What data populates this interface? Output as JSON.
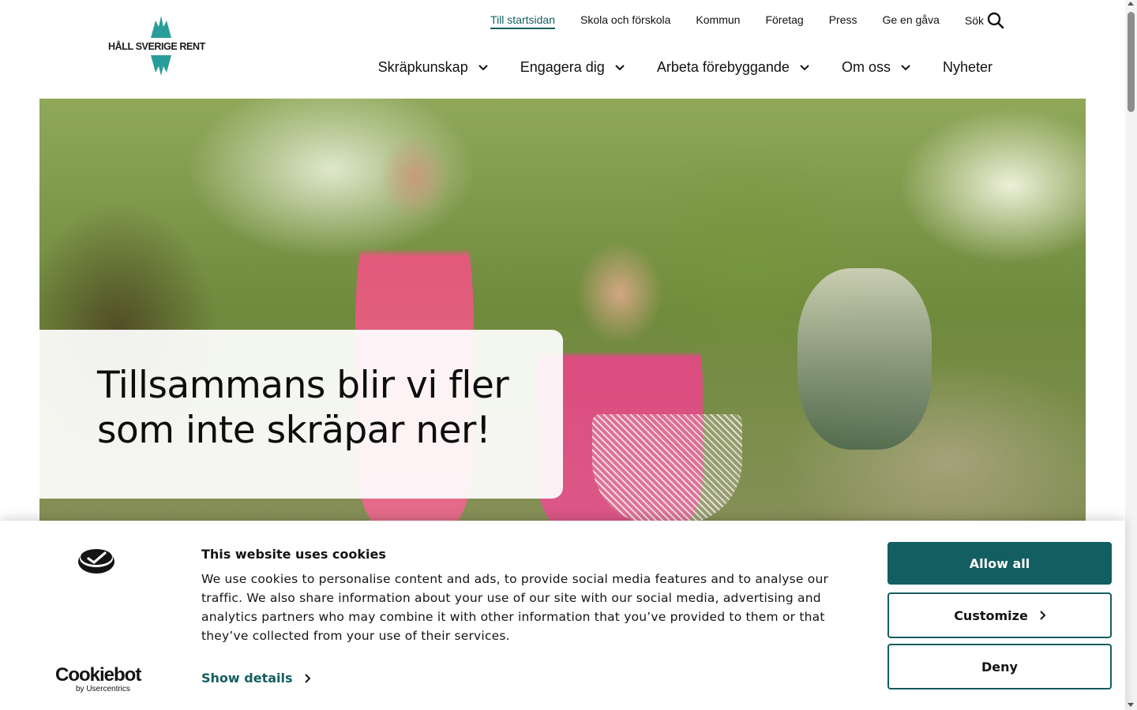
{
  "brand": {
    "logo_text": "HÅLL SVERIGE RENT"
  },
  "top_nav": [
    {
      "label": "Till startsidan",
      "active": true
    },
    {
      "label": "Skola och förskola"
    },
    {
      "label": "Kommun"
    },
    {
      "label": "Företag"
    },
    {
      "label": "Press"
    },
    {
      "label": "Ge en gåva"
    }
  ],
  "search": {
    "label": "Sök",
    "icon": "search-icon"
  },
  "main_nav": [
    {
      "label": "Skräpkunskap",
      "icon": "chevron-down-icon"
    },
    {
      "label": "Engagera dig",
      "icon": "chevron-down-icon"
    },
    {
      "label": "Arbeta förebyggande",
      "icon": "chevron-down-icon"
    },
    {
      "label": "Om oss",
      "icon": "chevron-down-icon"
    },
    {
      "label": "Nyheter"
    }
  ],
  "hero": {
    "title": "Tillsammans blir vi fler som inte skräpar ner!"
  },
  "cookie_banner": {
    "brand": "Cookiebot",
    "brand_by": "by Usercentrics",
    "title": "This website uses cookies",
    "text": "We use cookies to personalise content and ads, to provide social media features and to analyse our traffic. We also share information about your use of our site with our social media, advertising and analytics partners who may combine it with other information that you’ve provided to them or that they’ve collected from your use of their services.",
    "show_details": "Show details",
    "allow_all": "Allow all",
    "customize": "Customize",
    "deny": "Deny"
  },
  "colors": {
    "accent": "#135e60",
    "logo": "#2a9d9a",
    "text": "#111111"
  }
}
